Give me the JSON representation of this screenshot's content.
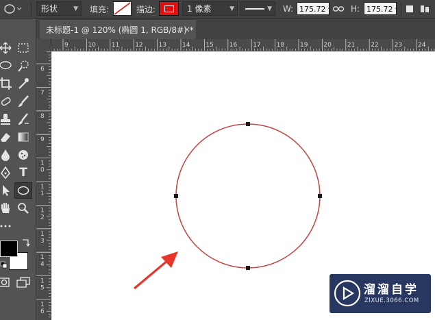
{
  "options_bar": {
    "shape_mode": "形状",
    "fill_label": "填充:",
    "stroke_label": "描边:",
    "stroke_width": "1 像素",
    "width_label": "W:",
    "width_value": "175.72 像素",
    "height_label": "H:",
    "height_value": "175.72 像素",
    "stroke_color": "#e01010"
  },
  "document": {
    "tab_title": "未标题-1 @ 120% (椭圆 1, RGB/8#) *",
    "close_glyph": "×"
  },
  "ruler": {
    "horizontal": [
      "9",
      "10",
      "11",
      "12",
      "13",
      "14",
      "15",
      "16",
      "17",
      "18",
      "19",
      "20",
      "21",
      "22",
      "23",
      "24"
    ],
    "vertical": [
      {
        "top": "6"
      },
      {
        "top": "7"
      },
      {
        "top": "8"
      },
      {
        "top": "9"
      },
      {
        "top": "1",
        "bottom": "0"
      },
      {
        "top": "1",
        "bottom": "1"
      },
      {
        "top": "1",
        "bottom": "2"
      },
      {
        "top": "1",
        "bottom": "3"
      },
      {
        "top": "1",
        "bottom": "4"
      },
      {
        "top": "1",
        "bottom": "5"
      },
      {
        "top": "1",
        "bottom": "6"
      }
    ]
  },
  "toolbar": {
    "type_tool_glyph": "T"
  },
  "shape": {
    "type": "ellipse",
    "stroke_color": "#d94a4a"
  },
  "arrow_color": "#e8362a",
  "watermark": {
    "name": "溜溜自学",
    "url": "ZIXUE.3066.COM"
  }
}
